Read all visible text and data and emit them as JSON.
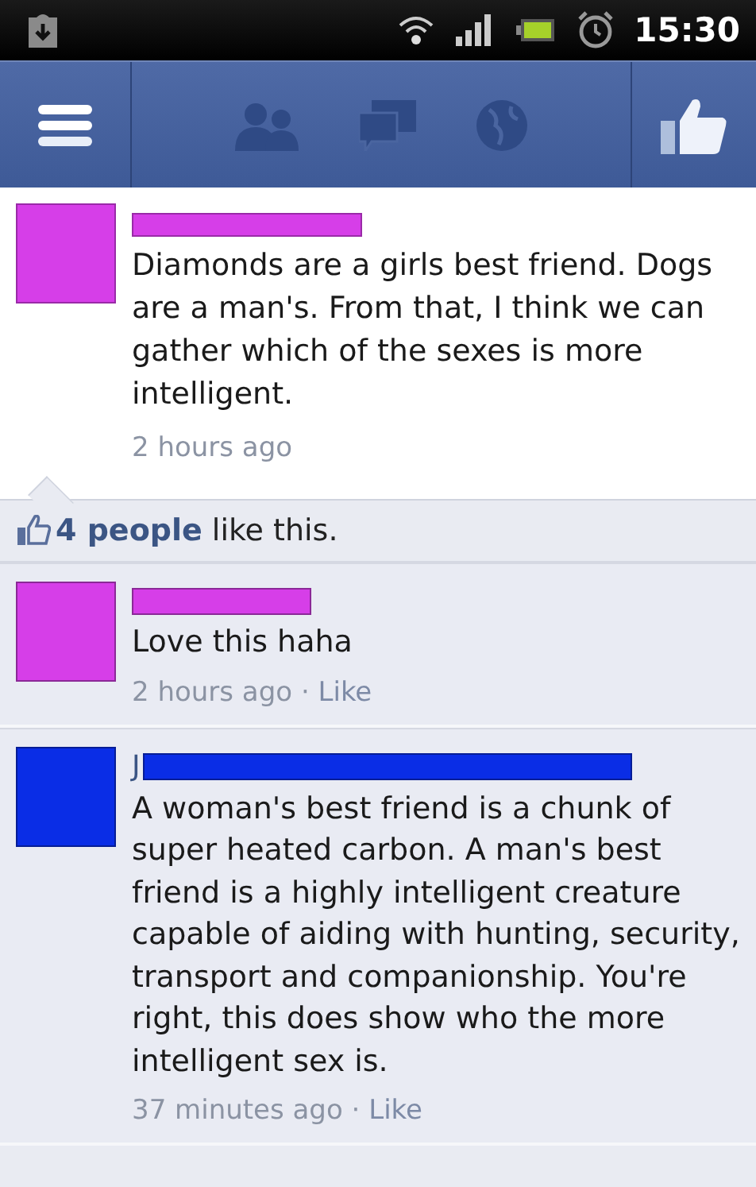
{
  "status_bar": {
    "time": "15:30"
  },
  "post": {
    "color": "#d63ee8",
    "text": "Diamonds are a girls best friend. Dogs are a man's. From that, I think we can gather which of the sexes is more intelligent.",
    "time": "2 hours ago"
  },
  "likes": {
    "text": "**4 people** like this."
  },
  "comments": [
    {
      "color": "#d63ee8",
      "text": "Love this haha",
      "time": "2 hours ago",
      "dot": "·",
      "action": "Like"
    },
    {
      "color": "#0a2de6",
      "author": "J",
      "text": "A woman's best friend is a chunk of super heated carbon. A man's best friend is a highly intelligent creature capable of aiding with hunting, security, transport and companionship. You're right, this does show who the more intelligent sex is.",
      "time": "37 minutes ago",
      "dot": "·",
      "action": "Like"
    }
  ]
}
